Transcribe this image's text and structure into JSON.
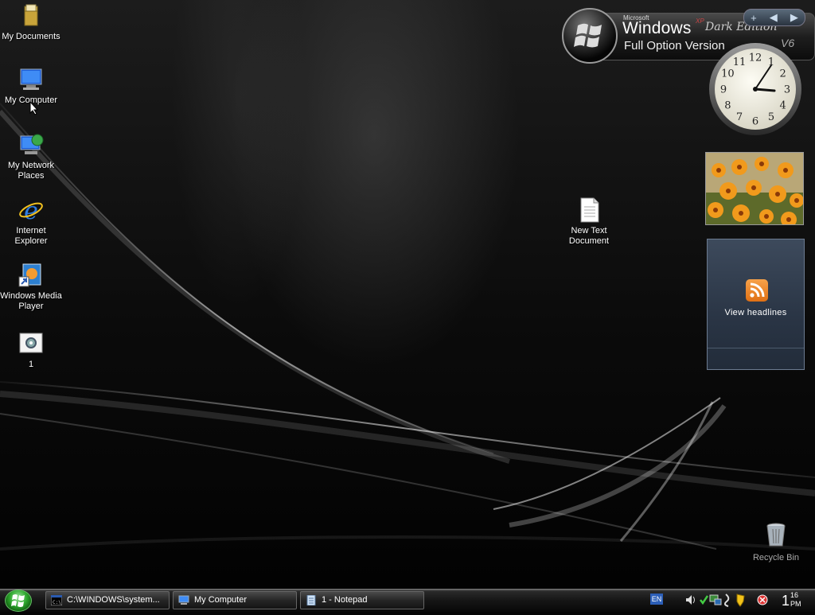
{
  "desktop": {
    "icons": [
      {
        "label": "My Documents"
      },
      {
        "label": "My Computer"
      },
      {
        "label": "My Network Places"
      },
      {
        "label": "Internet Explorer"
      },
      {
        "label": "Windows Media Player"
      },
      {
        "label": "1"
      },
      {
        "label": "New Text Document"
      }
    ],
    "recycle_bin": "Recycle Bin"
  },
  "branding": {
    "microsoft": "Microsoft",
    "windows": "Windows",
    "xp": "XP",
    "dark_edition": "Dark Edition",
    "version": "Full Option Version",
    "version_number": "V6"
  },
  "sidebar_controls": {
    "add": "+",
    "prev": "◀",
    "next": "▶"
  },
  "clock_gadget": {
    "numbers": [
      "12",
      "1",
      "2",
      "3",
      "4",
      "5",
      "6",
      "7",
      "8",
      "9",
      "10",
      "11"
    ]
  },
  "feed_gadget": {
    "label": "View headlines"
  },
  "taskbar": {
    "tasks": [
      {
        "label": "C:\\WINDOWS\\system..."
      },
      {
        "label": "My Computer"
      },
      {
        "label": "1 - Notepad"
      }
    ],
    "language": "EN",
    "clock": {
      "hour": "1",
      "minutes": "16",
      "ampm": "PM"
    }
  },
  "colors": {
    "accent_start": "#2ea82e",
    "rss": "#e07014"
  }
}
